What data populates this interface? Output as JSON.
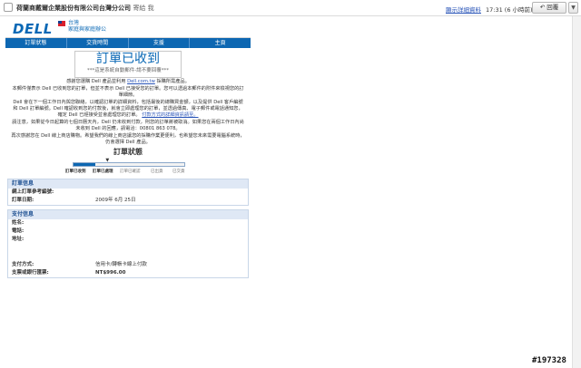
{
  "mail": {
    "sender": "荷蘭商戴爾企業股份有限公司台灣分公司",
    "recipient": "寄給 我",
    "details_link": "顯示詳細資料",
    "time": "17:31 (6 小時前)",
    "reply_label": "回覆",
    "more_label": "▼"
  },
  "dell": {
    "logo": "DELL",
    "region_line1": "台灣",
    "region_line2": "家庭與家庭辦公",
    "tabs": [
      "訂單狀態",
      "交貨時間",
      "支援",
      "主頁"
    ]
  },
  "order": {
    "title": "訂單已收到",
    "subtitle": "***這是系統自動郵件-請不要回覆***",
    "thanks_pre": "感謝您選購 Dell 產品並利用",
    "thanks_link": "Dell.com.tw",
    "thanks_post": "採購所需產品。",
    "para1": "本郵件僅表示 Dell 已收到您的訂單，但並不表示 Dell 已接受您的訂單。您可以透過本郵件的附件來檢視您的訂單細節。",
    "para2_text": "Dell 會在下一個工作日內與您聯絡，以確認訂單的詳細資料，包括最後的總購買金額，以及提供 Dell 客戶編號和 Dell 訂單編號。Dell 確認收到您的付款後，就會立即處理您的訂單，並透過傳真、電子郵件或電話通知您，確定 Dell 已經接受並會處理您的訂單。",
    "para2_link": "付款方式的詳細資訊請至。",
    "para3": "請注意，如果從今日起算的七個日曆天內，Dell 仍未收到付款，則您的訂單將被取消。如果您在兩個工作日內尚未收到 Dell 的回應，請電洽：00801 863 078。",
    "para4": "再次感謝您在 Dell 線上商店購物。希望我們的線上商店讓您的採購作業更便利，也希望您未來需要電腦系統時，仍會選擇 Dell 產品。",
    "status_title": "訂單狀態",
    "progress_fraction": 0.2,
    "steps": [
      "訂單已收到",
      "訂單已處理",
      "訂單已確認",
      "已出貨",
      "已交貨"
    ],
    "active_step": 1
  },
  "order_info": {
    "header": "訂單信息",
    "ref_label": "網上訂單參考編號:",
    "ref_value": "",
    "date_label": "訂單日期:",
    "date_value": "2009年 6月 25日"
  },
  "payment_info": {
    "header": "支付信息",
    "name_label": "姓名:",
    "phone_label": "電話:",
    "address_label": "地址:",
    "method_label": "支付方式:",
    "method_value": "信用卡/轉帳卡線上付款",
    "amount_label": "支票或銀行匯票:",
    "amount_value": "NT$996.00"
  },
  "watermark": "#197328"
}
